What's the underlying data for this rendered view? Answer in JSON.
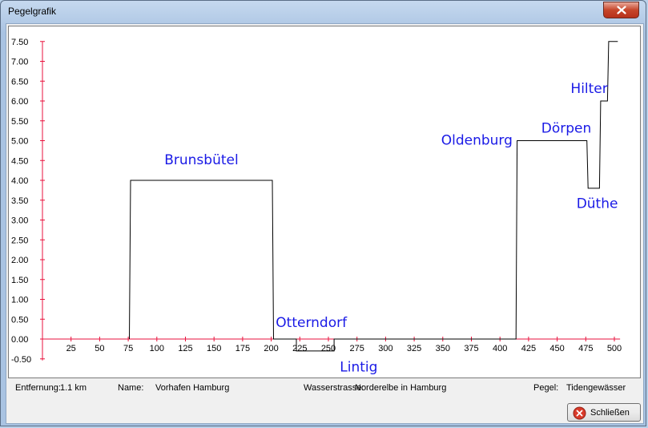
{
  "window": {
    "title": "Pegelgrafik"
  },
  "status": {
    "distance_label": "Entfernung:",
    "distance_value": "1.1 km",
    "name_label": "Name:",
    "name_value": "Vorhafen Hamburg",
    "waterway_label": "Wasserstrasse:",
    "waterway_value": "Norderelbe in Hamburg",
    "gauge_label": "Pegel:",
    "gauge_value": "Tidengewässer"
  },
  "buttons": {
    "close_label": "Schließen"
  },
  "colors": {
    "axis": "#e8123c",
    "line": "#000000",
    "station_label": "#1a1ae6",
    "tick_text": "#000000"
  },
  "chart_data": {
    "type": "line",
    "title": "",
    "xlabel": "",
    "ylabel": "",
    "xlim": [
      0,
      505
    ],
    "ylim": [
      -0.5,
      7.5
    ],
    "grid": false,
    "x_ticks": [
      "25",
      "50",
      "75",
      "100",
      "125",
      "150",
      "175",
      "200",
      "225",
      "250",
      "275",
      "300",
      "325",
      "350",
      "375",
      "400",
      "425",
      "450",
      "475",
      "500"
    ],
    "y_ticks": [
      "7.50",
      "7.00",
      "6.50",
      "6.00",
      "5.50",
      "5.00",
      "4.50",
      "4.00",
      "3.50",
      "3.00",
      "2.50",
      "2.00",
      "1.50",
      "1.00",
      "0.50",
      "0.00",
      "-0.50"
    ],
    "series": [
      {
        "points": [
          [
            76,
            0
          ],
          [
            77,
            4.0
          ],
          [
            201,
            4.0
          ],
          [
            202,
            0
          ],
          [
            222,
            0
          ],
          [
            222,
            -0.3
          ],
          [
            255,
            -0.3
          ],
          [
            255,
            0
          ],
          [
            414,
            0
          ],
          [
            415,
            5.0
          ],
          [
            476,
            5.0
          ],
          [
            477,
            3.8
          ],
          [
            487,
            3.8
          ],
          [
            488,
            6.0
          ],
          [
            494,
            6.0
          ],
          [
            495,
            7.5
          ],
          [
            503,
            7.5
          ]
        ]
      }
    ],
    "annotations": [
      {
        "text": "Brunsbütel",
        "x": 139,
        "y": 4.4,
        "anchor": "middle"
      },
      {
        "text": "Otterndorf",
        "x": 204,
        "y": 0.3,
        "anchor": "start"
      },
      {
        "text": "Lintig",
        "x": 260,
        "y": -0.82,
        "anchor": "start"
      },
      {
        "text": "Oldenburg",
        "x": 411,
        "y": 4.9,
        "anchor": "end"
      },
      {
        "text": "Dörpen",
        "x": 458,
        "y": 5.2,
        "anchor": "middle"
      },
      {
        "text": "Düthe",
        "x": 485,
        "y": 3.3,
        "anchor": "middle"
      },
      {
        "text": "Hilter",
        "x": 478,
        "y": 6.2,
        "anchor": "middle"
      }
    ]
  }
}
